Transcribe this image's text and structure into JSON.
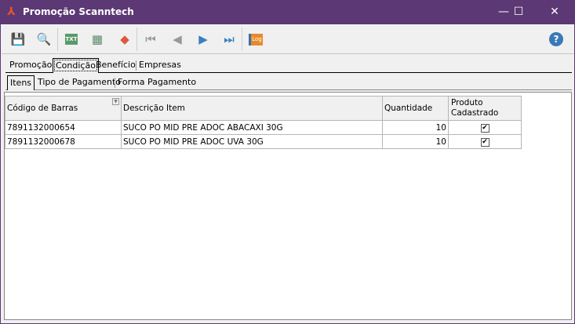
{
  "window": {
    "title": "Promoção Scanntech",
    "accent": "#5c3874"
  },
  "toolbar": {
    "buttons": [
      "save-icon",
      "search-icon",
      "export-txt-icon",
      "grid-icon",
      "eraser-icon",
      "first-icon",
      "previous-icon",
      "next-icon",
      "last-icon",
      "log-icon",
      "help-icon"
    ]
  },
  "tabs": [
    {
      "label": "Promoção"
    },
    {
      "label": "Condição"
    },
    {
      "label": "Benefício"
    },
    {
      "label": "Empresas"
    }
  ],
  "subtabs": [
    {
      "label": "Itens"
    },
    {
      "label": "Tipo de Pagamento"
    },
    {
      "label": "Forma Pagamento"
    }
  ],
  "grid": {
    "columns": [
      "Código de Barras",
      "Descrição Item",
      "Quantidade",
      "Produto Cadastrado"
    ],
    "rows": [
      {
        "barcode": "7891132000654",
        "description": "SUCO PO MID PRE ADOC ABACAXI 30G",
        "quantity": "10",
        "registered": true
      },
      {
        "barcode": "7891132000678",
        "description": "SUCO PO MID PRE ADOC UVA 30G",
        "quantity": "10",
        "registered": true
      }
    ]
  }
}
